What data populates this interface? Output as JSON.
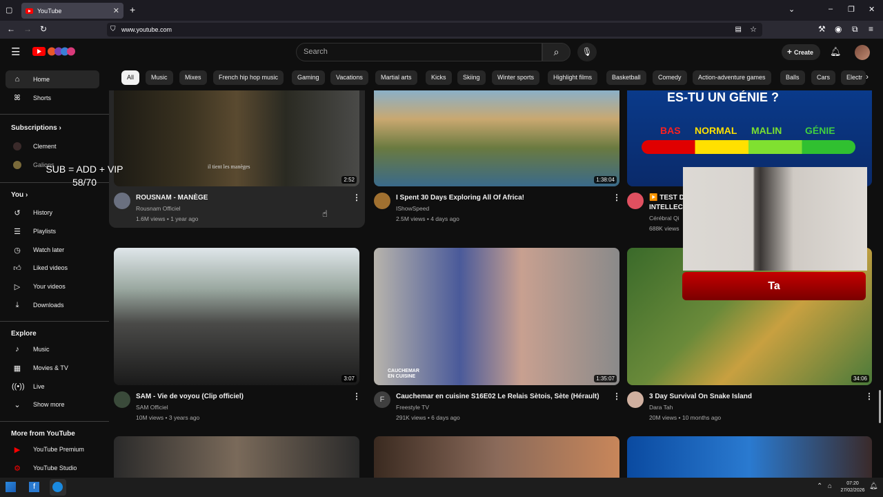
{
  "browser": {
    "tab_title": "YouTube",
    "url": "www.youtube.com"
  },
  "header": {
    "search_placeholder": "Search",
    "create_label": "Create"
  },
  "chips": [
    "All",
    "Music",
    "Mixes",
    "French hip hop music",
    "Gaming",
    "Vacations",
    "Martial arts",
    "Kicks",
    "Skiing",
    "Winter sports",
    "Highlight films",
    "Basketball",
    "Comedy",
    "Action-adventure games",
    "Balls",
    "Cars",
    "Electr"
  ],
  "sidebar": {
    "home": "Home",
    "shorts": "Shorts",
    "subscriptions": "Subscriptions",
    "subs": [
      "Clement",
      "Galions"
    ],
    "you": "You",
    "you_items": [
      "History",
      "Playlists",
      "Watch later",
      "Liked videos",
      "Your videos",
      "Downloads"
    ],
    "explore": "Explore",
    "explore_items": [
      "Music",
      "Movies & TV",
      "Live",
      "Show more"
    ],
    "more_from": "More from YouTube",
    "more_items": [
      "YouTube Premium",
      "YouTube Studio"
    ]
  },
  "overlay": {
    "line1": "SUB = ADD + VIP",
    "line2": "58/70",
    "ta": "Ta"
  },
  "videos": [
    {
      "title": "ROUSNAM - MANÈGE",
      "channel": "Rousnam Officiel",
      "meta": "1.6M views • 1 year ago",
      "duration": "2:52",
      "caption": "il tient les manèges"
    },
    {
      "title": "I Spent 30 Days Exploring All Of Africa!",
      "channel": "IShowSpeed",
      "meta": "2.5M views • 4 days ago",
      "duration": "1:38:04"
    },
    {
      "title": "▶️ TEST D",
      "title2": "INTELLECT",
      "channel": "Cérébral Qi",
      "meta": "688K views",
      "thumb_text": "ES-TU UN GÉNIE ?",
      "levels": [
        "BAS",
        "NORMAL",
        "MALIN",
        "GÉNIE"
      ]
    },
    {
      "title": "SAM - Vie de voyou (Clip officiel)",
      "channel": "SAM Officiel",
      "meta": "10M views • 3 years ago",
      "duration": "3:07"
    },
    {
      "title": "Cauchemar en cuisine S16E02 Le Relais Sètois, Sète (Hérault)",
      "channel": "Freestyle TV",
      "meta": "291K views • 6 days ago",
      "duration": "1:35:07",
      "avatar_letter": "F",
      "thumb_text": "CAUCHEMAR EN CUISINE"
    },
    {
      "title": "3 Day Survival On Snake Island",
      "channel": "Dara Tah",
      "meta": "20M views • 10 months ago",
      "duration": "34:06"
    }
  ],
  "taskbar": {
    "time": "07:20",
    "date": "27/02/2026"
  },
  "colors": {
    "accent": "#ff0000",
    "bg": "#0f0f0f",
    "chip": "#272727"
  }
}
